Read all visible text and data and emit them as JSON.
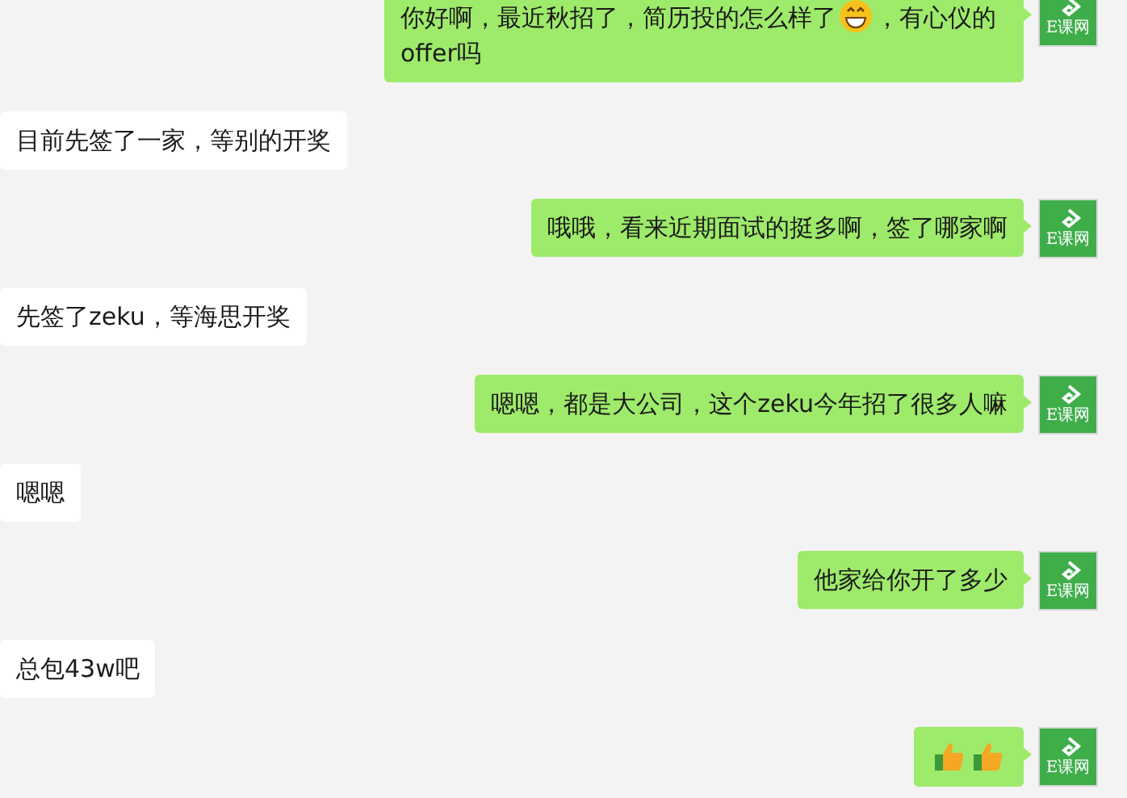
{
  "messages": [
    {
      "outgoing": true,
      "avatar_label": "E课网",
      "parts": [
        {
          "kind": "text",
          "text": "你好啊，最近秋招了，简历投的怎么样了"
        },
        {
          "kind": "grin"
        },
        {
          "kind": "text",
          "text": "，有心仪的"
        },
        {
          "kind": "text",
          "text": "offer吗"
        }
      ]
    },
    {
      "outgoing": false,
      "parts": [
        {
          "kind": "text",
          "text": "目前先签了一家，等别的开奖"
        }
      ]
    },
    {
      "outgoing": true,
      "avatar_label": "E课网",
      "parts": [
        {
          "kind": "text",
          "text": "哦哦，看来近期面试的挺多啊，签了哪家啊"
        }
      ]
    },
    {
      "outgoing": false,
      "parts": [
        {
          "kind": "text",
          "text": "先签了zeku，等海思开奖"
        }
      ]
    },
    {
      "outgoing": true,
      "avatar_label": "E课网",
      "parts": [
        {
          "kind": "text",
          "text": "嗯嗯，都是大公司，这个zeku今年招了很多人嘛"
        }
      ]
    },
    {
      "outgoing": false,
      "parts": [
        {
          "kind": "text",
          "text": "嗯嗯"
        }
      ]
    },
    {
      "outgoing": true,
      "avatar_label": "E课网",
      "parts": [
        {
          "kind": "text",
          "text": "他家给你开了多少"
        }
      ]
    },
    {
      "outgoing": false,
      "parts": [
        {
          "kind": "text",
          "text": "总包43w吧"
        }
      ]
    },
    {
      "outgoing": true,
      "avatar_label": "E课网",
      "parts": [
        {
          "kind": "thumbs-up"
        },
        {
          "kind": "thumbs-up"
        }
      ]
    }
  ]
}
